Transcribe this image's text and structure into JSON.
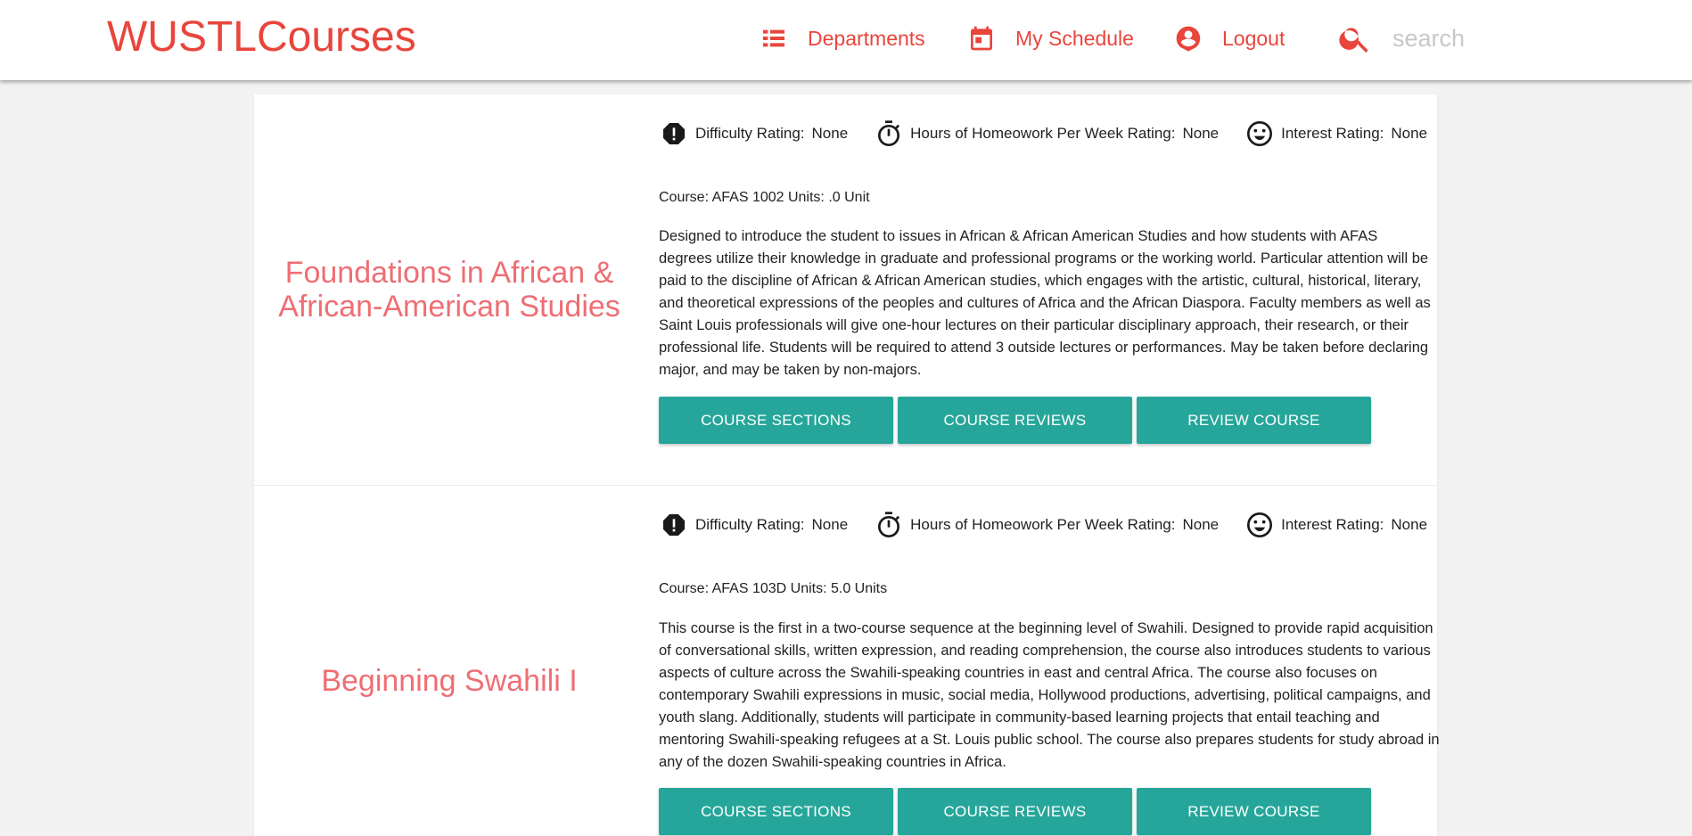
{
  "navbar": {
    "brand": "WUSTLCourses",
    "departments_label": "Departments",
    "schedule_label": "My Schedule",
    "logout_label": "Logout",
    "search_placeholder": "search",
    "accent_color": "#e8453c",
    "icons": [
      "view-list-icon",
      "calendar-icon",
      "account-circle-icon",
      "search-icon"
    ]
  },
  "ratings_labels": {
    "difficulty": "Difficulty Rating:",
    "homework": "Hours of Homeowork Per Week Rating:",
    "interest": "Interest Rating:"
  },
  "courses": [
    {
      "title_line1": "Foundations in African &",
      "title_line2": "African-American Studies",
      "difficulty": "None",
      "homework": "None",
      "interest": "None",
      "meta": "Course: AFAS 1002 Units: .0 Unit",
      "description": "Designed to introduce the student to issues in African & African American Studies and how students with AFAS degrees utilize their knowledge in graduate and professional programs or the working world. Particular attention will be paid to the discipline of African & African American studies, which engages with the artistic, cultural, historical, literary, and theoretical expressions of the peoples and cultures of Africa and the African Diaspora. Faculty members as well as Saint Louis professionals will give one-hour lectures on their particular disciplinary approach, their research, or their professional life. Students will be required to attend 3 outside lectures or performances. May be taken before declaring major, and may be taken by non-majors."
    },
    {
      "title_line1": "Beginning Swahili I",
      "difficulty": "None",
      "homework": "None",
      "interest": "None",
      "meta": "Course: AFAS 103D Units: 5.0 Units",
      "description": "This course is the first in a two-course sequence at the beginning level of Swahili. Designed to provide rapid acquisition of conversational skills, written expression, and reading comprehension, the course also introduces students to various aspects of culture across the Swahili-speaking countries in east and central Africa. The course also focuses on contemporary Swahili expressions in music, social media, Hollywood productions, advertising, political campaigns, and youth slang. Additionally, students will participate in community-based learning projects that entail teaching and mentoring Swahili-speaking refugees at a St. Louis public school. The course also prepares students for study abroad in any of the dozen Swahili-speaking countries in Africa."
    }
  ],
  "buttons": {
    "sections": "COURSE SECTIONS",
    "reviews": "COURSE REVIEWS",
    "review_course": "REVIEW COURSE",
    "color": "#26a69a"
  },
  "colors": {
    "title": "#ee6e73",
    "background": "#f2f2f2"
  }
}
